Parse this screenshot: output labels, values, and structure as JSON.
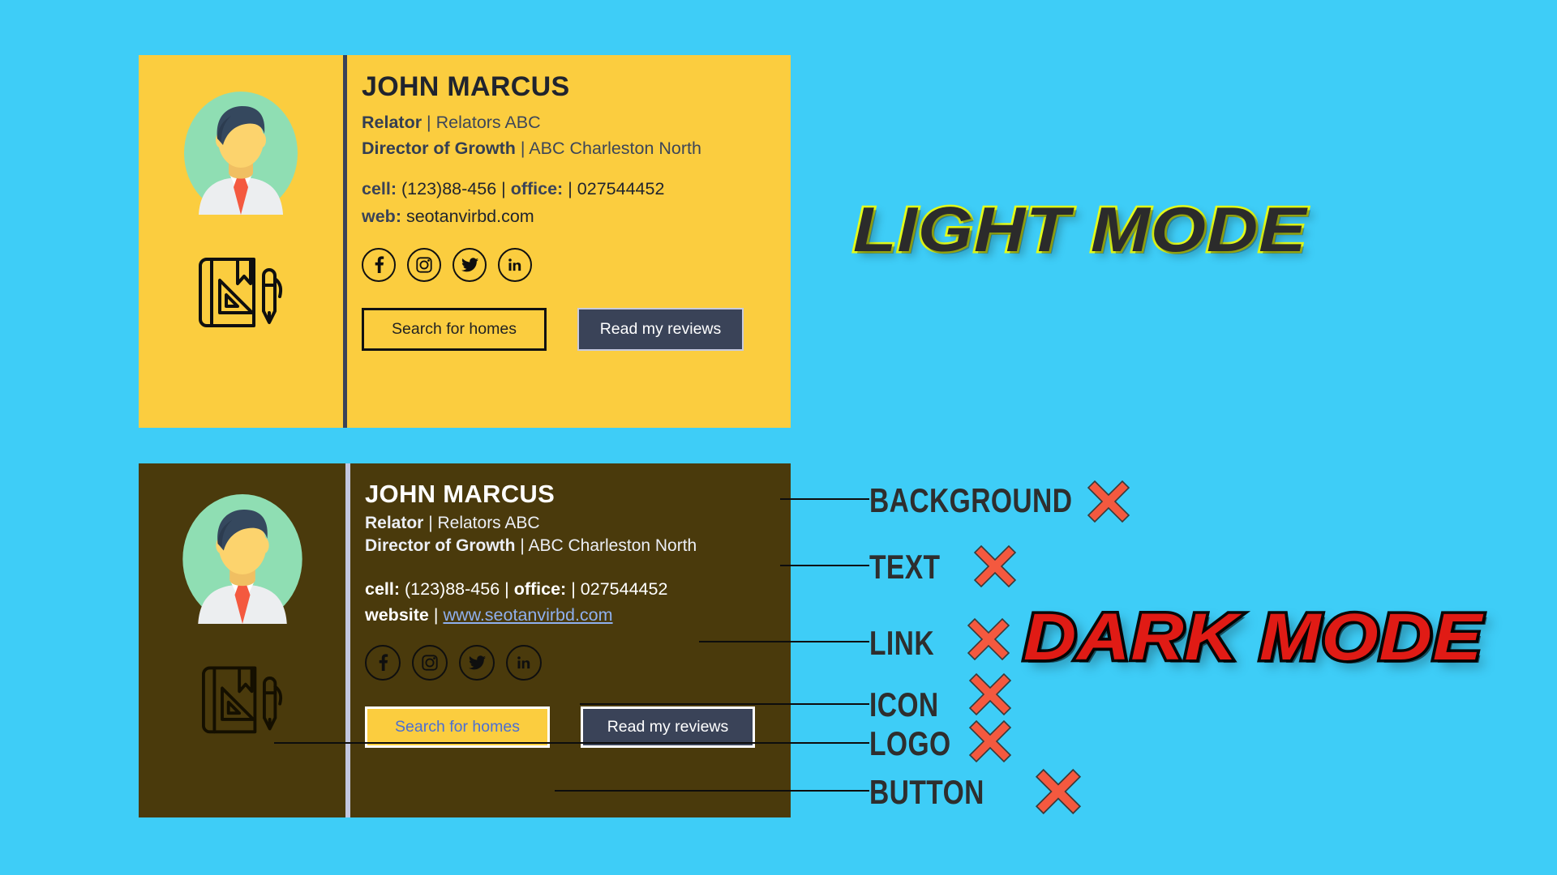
{
  "page": {
    "background_color": "#3ecdf7"
  },
  "light_card": {
    "background_color": "#fbcd3f",
    "divider_color": "#3a4358",
    "name": "JOHN MARCUS",
    "role_lines": [
      {
        "strong": "Relator",
        "separator": " | ",
        "rest": "Relators ABC"
      },
      {
        "strong": "Director of Growth",
        "separator": " | ",
        "rest": "ABC Charleston North"
      }
    ],
    "contact": {
      "cell_label": "cell:",
      "cell_value": "(123)88-456",
      "pipe": "|",
      "office_label": "office:",
      "office_sep": "|",
      "office_value": "027544452",
      "web_label": "web:",
      "web_value": "seotanvirbd.com"
    },
    "socials": [
      {
        "icon": "facebook-icon",
        "glyph": "f"
      },
      {
        "icon": "instagram-icon",
        "glyph": ""
      },
      {
        "icon": "twitter-icon",
        "glyph": ""
      },
      {
        "icon": "linkedin-icon",
        "glyph": "in"
      }
    ],
    "buttons": {
      "primary_label": "Search for homes",
      "secondary_label": "Read my reviews"
    },
    "logo": "book-pen-logo",
    "avatar": "male-avatar"
  },
  "dark_card": {
    "background_color": "#4a3a0c",
    "divider_color": "#c3c7e0",
    "name": "JOHN MARCUS",
    "role_lines": [
      {
        "strong": "Relator",
        "separator": " | ",
        "rest": "Relators ABC"
      },
      {
        "strong": "Director of Growth",
        "separator": " | ",
        "rest": "ABC Charleston North"
      }
    ],
    "contact": {
      "cell_label": "cell:",
      "cell_value": "(123)88-456",
      "pipe": "|",
      "office_label": "office:",
      "office_sep": "|",
      "office_value": "027544452",
      "web_label": "website",
      "web_sep": "|",
      "web_link": "www.seotanvirbd.com",
      "link_color": "#8fb0ee"
    },
    "socials": [
      {
        "icon": "facebook-icon",
        "glyph": "f"
      },
      {
        "icon": "instagram-icon",
        "glyph": ""
      },
      {
        "icon": "twitter-icon",
        "glyph": ""
      },
      {
        "icon": "linkedin-icon",
        "glyph": "in"
      }
    ],
    "buttons": {
      "primary_label": "Search for homes",
      "primary_text_color": "#4a6fd4",
      "secondary_label": "Read my reviews"
    },
    "logo": "book-pen-logo",
    "avatar": "male-avatar"
  },
  "headings": {
    "light": "LIGHT MODE",
    "light_fill_color": "#2b2b2b",
    "light_outline_color": "#e6ff1a",
    "dark": "DARK MODE",
    "dark_fill_color": "#e01b15",
    "dark_outline_color": "#0a0a0a"
  },
  "annotations": {
    "cross_color": "#f4593f",
    "items": [
      {
        "label": "BACKGROUND"
      },
      {
        "label": "TEXT"
      },
      {
        "label": "LINK"
      },
      {
        "label": "ICON"
      },
      {
        "label": "LOGO"
      },
      {
        "label": "BUTTON"
      }
    ]
  }
}
